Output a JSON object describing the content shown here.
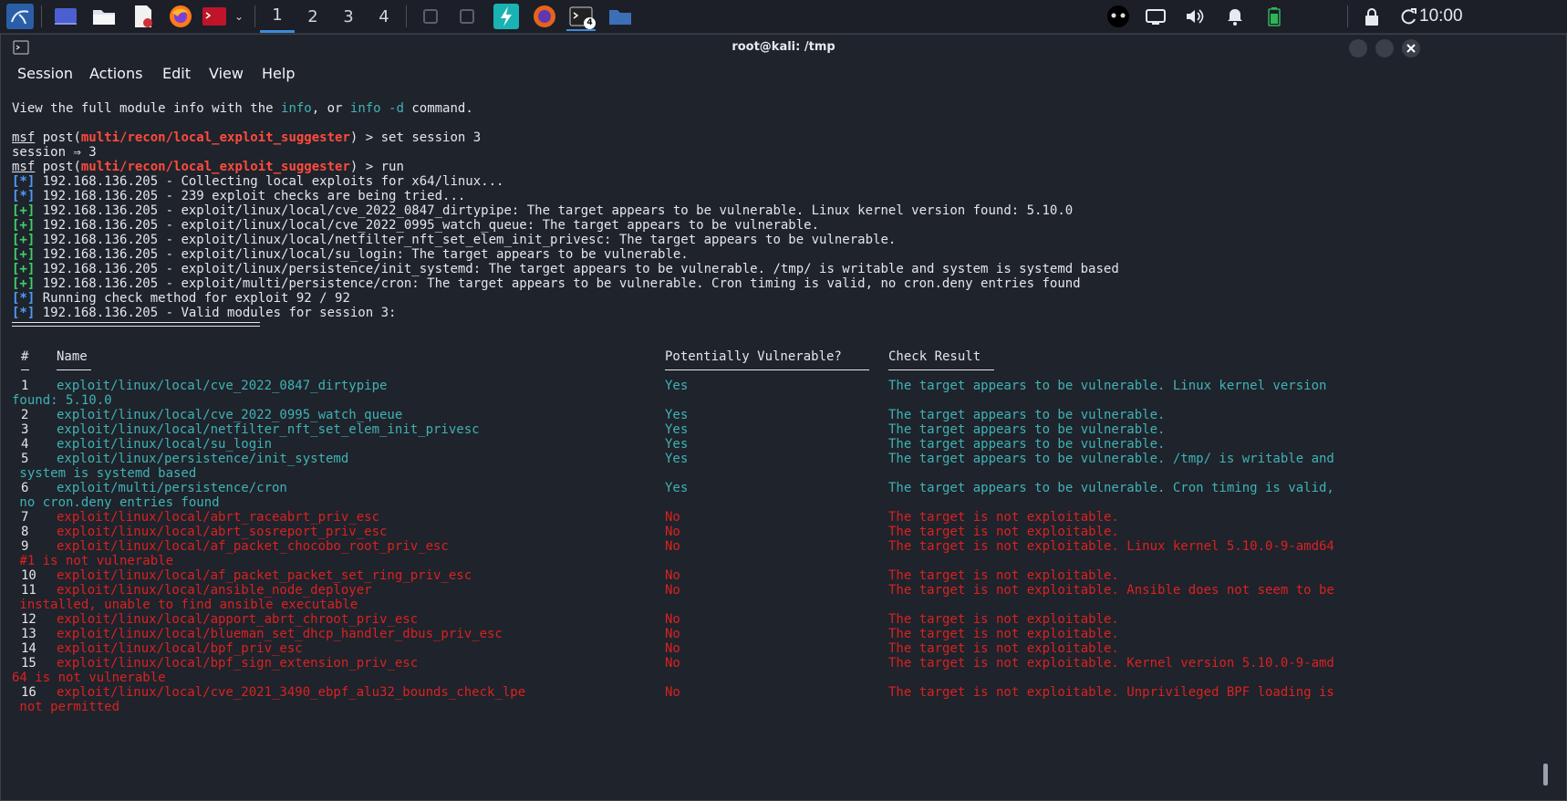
{
  "panel": {
    "workspaces": [
      "1",
      "2",
      "3",
      "4"
    ],
    "active_workspace": "1",
    "clock": "10:00",
    "terminal_task_count": "4",
    "icons": [
      "kali-menu-icon",
      "show-desktop-icon",
      "file-manager-icon",
      "text-editor-icon",
      "firefox-icon",
      "terminal-icon",
      "chevron-down-icon",
      "window-icon",
      "window-icon",
      "lightning-icon",
      "firefox-icon",
      "terminal-icon",
      "folder-icon",
      "mask-icon",
      "display-icon",
      "volume-icon",
      "bell-icon",
      "battery-icon",
      "lock-icon",
      "refresh-icon"
    ]
  },
  "window": {
    "title": "root@kali: /tmp",
    "menu": [
      "Session",
      "Actions",
      "Edit",
      "View",
      "Help"
    ]
  },
  "terminal": {
    "info_line": {
      "pre": "View the full module info with the ",
      "info": "info",
      "mid": ", or ",
      "info_d": "info -d",
      "post": " command."
    },
    "prompt_msf": "msf",
    "prompt_post": " post(",
    "prompt_module": "multi/recon/local_exploit_suggester",
    "prompt_end": ") > ",
    "cmd1": "set session 3",
    "session_out": "session ⇒ 3",
    "cmd2": "run",
    "status_lines": [
      {
        "tag": "[*]",
        "kind": "info",
        "text": " 192.168.136.205 - Collecting local exploits for x64/linux..."
      },
      {
        "tag": "[*]",
        "kind": "info",
        "text": " 192.168.136.205 - 239 exploit checks are being tried..."
      },
      {
        "tag": "[+]",
        "kind": "good",
        "text": " 192.168.136.205 - exploit/linux/local/cve_2022_0847_dirtypipe: The target appears to be vulnerable. Linux kernel version found: 5.10.0"
      },
      {
        "tag": "[+]",
        "kind": "good",
        "text": " 192.168.136.205 - exploit/linux/local/cve_2022_0995_watch_queue: The target appears to be vulnerable."
      },
      {
        "tag": "[+]",
        "kind": "good",
        "text": " 192.168.136.205 - exploit/linux/local/netfilter_nft_set_elem_init_privesc: The target appears to be vulnerable."
      },
      {
        "tag": "[+]",
        "kind": "good",
        "text": " 192.168.136.205 - exploit/linux/local/su_login: The target appears to be vulnerable."
      },
      {
        "tag": "[+]",
        "kind": "good",
        "text": " 192.168.136.205 - exploit/linux/persistence/init_systemd: The target appears to be vulnerable. /tmp/ is writable and system is systemd based"
      },
      {
        "tag": "[+]",
        "kind": "good",
        "text": " 192.168.136.205 - exploit/multi/persistence/cron: The target appears to be vulnerable. Cron timing is valid, no cron.deny entries found"
      },
      {
        "tag": "[*]",
        "kind": "info",
        "text": " Running check method for exploit 92 / 92"
      },
      {
        "tag": "[*]",
        "kind": "info",
        "text": " 192.168.136.205 - Valid modules for session 3:"
      }
    ],
    "table_headers": [
      "#",
      "Name",
      "Potentially Vulnerable?",
      "Check Result"
    ],
    "table_rows": [
      {
        "num": "1",
        "name": "exploit/linux/local/cve_2022_0847_dirtypipe",
        "vuln": "Yes",
        "result": "The target appears to be vulnerable. Linux kernel version",
        "cont": "found: 5.10.0",
        "status": "ok"
      },
      {
        "num": "2",
        "name": "exploit/linux/local/cve_2022_0995_watch_queue",
        "vuln": "Yes",
        "result": "The target appears to be vulnerable.",
        "cont": "",
        "status": "ok"
      },
      {
        "num": "3",
        "name": "exploit/linux/local/netfilter_nft_set_elem_init_privesc",
        "vuln": "Yes",
        "result": "The target appears to be vulnerable.",
        "cont": "",
        "status": "ok"
      },
      {
        "num": "4",
        "name": "exploit/linux/local/su_login",
        "vuln": "Yes",
        "result": "The target appears to be vulnerable.",
        "cont": "",
        "status": "ok"
      },
      {
        "num": "5",
        "name": "exploit/linux/persistence/init_systemd",
        "vuln": "Yes",
        "result": "The target appears to be vulnerable. /tmp/ is writable and",
        "cont": " system is systemd based",
        "status": "ok"
      },
      {
        "num": "6",
        "name": "exploit/multi/persistence/cron",
        "vuln": "Yes",
        "result": "The target appears to be vulnerable. Cron timing is valid,",
        "cont": " no cron.deny entries found",
        "status": "ok"
      },
      {
        "num": "7",
        "name": "exploit/linux/local/abrt_raceabrt_priv_esc",
        "vuln": "No",
        "result": "The target is not exploitable.",
        "cont": "",
        "status": "bad"
      },
      {
        "num": "8",
        "name": "exploit/linux/local/abrt_sosreport_priv_esc",
        "vuln": "No",
        "result": "The target is not exploitable.",
        "cont": "",
        "status": "bad"
      },
      {
        "num": "9",
        "name": "exploit/linux/local/af_packet_chocobo_root_priv_esc",
        "vuln": "No",
        "result": "The target is not exploitable. Linux kernel 5.10.0-9-amd64",
        "cont": " #1 is not vulnerable",
        "status": "bad"
      },
      {
        "num": "10",
        "name": "exploit/linux/local/af_packet_packet_set_ring_priv_esc",
        "vuln": "No",
        "result": "The target is not exploitable.",
        "cont": "",
        "status": "bad"
      },
      {
        "num": "11",
        "name": "exploit/linux/local/ansible_node_deployer",
        "vuln": "No",
        "result": "The target is not exploitable. Ansible does not seem to be",
        "cont": " installed, unable to find ansible executable",
        "status": "bad"
      },
      {
        "num": "12",
        "name": "exploit/linux/local/apport_abrt_chroot_priv_esc",
        "vuln": "No",
        "result": "The target is not exploitable.",
        "cont": "",
        "status": "bad"
      },
      {
        "num": "13",
        "name": "exploit/linux/local/blueman_set_dhcp_handler_dbus_priv_esc",
        "vuln": "No",
        "result": "The target is not exploitable.",
        "cont": "",
        "status": "bad"
      },
      {
        "num": "14",
        "name": "exploit/linux/local/bpf_priv_esc",
        "vuln": "No",
        "result": "The target is not exploitable.",
        "cont": "",
        "status": "bad"
      },
      {
        "num": "15",
        "name": "exploit/linux/local/bpf_sign_extension_priv_esc",
        "vuln": "No",
        "result": "The target is not exploitable. Kernel version 5.10.0-9-amd",
        "cont": "64 is not vulnerable",
        "status": "bad"
      },
      {
        "num": "16",
        "name": "exploit/linux/local/cve_2021_3490_ebpf_alu32_bounds_check_lpe",
        "vuln": "No",
        "result": "The target is not exploitable. Unprivileged BPF loading is",
        "cont": " not permitted",
        "status": "bad"
      }
    ]
  },
  "colors": {
    "module_red": "#ff4b3d",
    "keyword_cyan": "#3fb3b6",
    "info_blue": "#4f9cf9",
    "good_green": "#3fd16b",
    "bad_red": "#d92222"
  }
}
